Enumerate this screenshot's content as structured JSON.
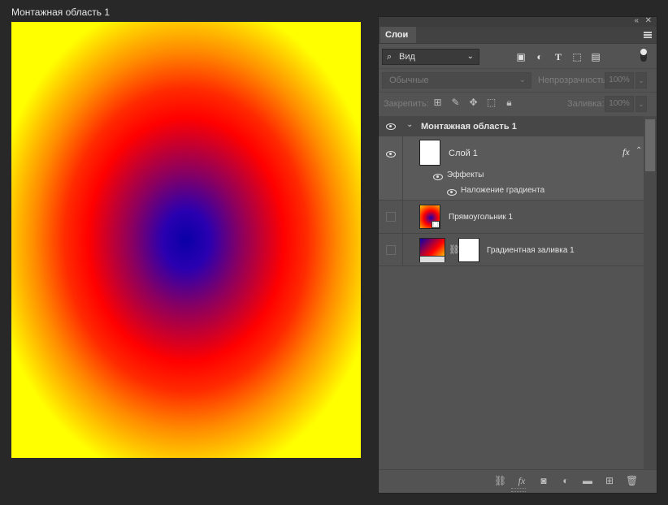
{
  "artboard": {
    "title": "Монтажная область 1"
  },
  "panel": {
    "tab": "Слои",
    "filter": {
      "label": "Вид"
    },
    "blend_mode": "Обычные",
    "opacity_label": "Непрозрачность:",
    "opacity_value": "100%",
    "lock_label": "Закрепить:",
    "fill_label": "Заливка:",
    "fill_value": "100%",
    "layers": {
      "artboard": "Монтажная область 1",
      "layer1": "Слой 1",
      "fx": "fx",
      "effects": "Эффекты",
      "gradient_overlay": "Наложение градиента",
      "rectangle": "Прямоугольник 1",
      "gradient_fill": "Градиентная заливка 1"
    }
  },
  "colors": {
    "canvas_gradient": [
      "#0a00a8",
      "#ff0000",
      "#ff8c00",
      "#ffff00"
    ],
    "panel_bg": "#535353",
    "app_bg": "#282828"
  }
}
